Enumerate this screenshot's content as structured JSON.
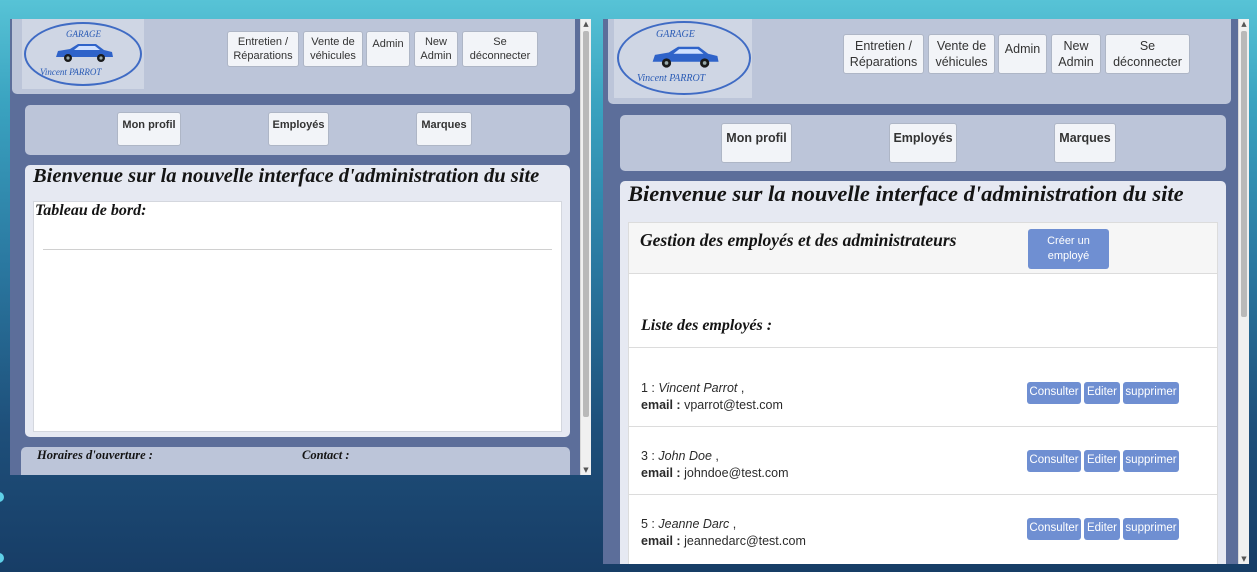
{
  "logo": {
    "top": "GARAGE",
    "bottom": "Vincent PARROT"
  },
  "nav": {
    "entretien": [
      "Entretien /",
      "Réparations"
    ],
    "vente": [
      "Vente de",
      "véhicules"
    ],
    "admin": "Admin",
    "new_admin": [
      "New",
      "Admin"
    ],
    "logout": [
      "Se",
      "déconnecter"
    ]
  },
  "subnav": {
    "profil": "Mon profil",
    "employes": "Employés",
    "marques": "Marques"
  },
  "page_title": "Bienvenue sur la nouvelle interface d'administration du site",
  "left": {
    "dashboard_title": "Tableau de bord:",
    "footer": {
      "hours": "Horaires d'ouverture :",
      "contact": "Contact :"
    }
  },
  "right": {
    "section_title": "Gestion des employés et des administrateurs",
    "create_button": [
      "Créer un",
      "employé"
    ],
    "list_title": "Liste des employés :",
    "email_label": "email :",
    "actions": {
      "view": "Consulter",
      "edit": "Editer",
      "delete": "supprimer"
    },
    "employees": [
      {
        "id": "1 :",
        "name": "Vincent Parrot",
        "email": "vparrot@test.com"
      },
      {
        "id": "3 :",
        "name": "John Doe",
        "email": "johndoe@test.com"
      },
      {
        "id": "5 :",
        "name": "Jeanne Darc",
        "email": "jeannedarc@test.com"
      }
    ]
  }
}
